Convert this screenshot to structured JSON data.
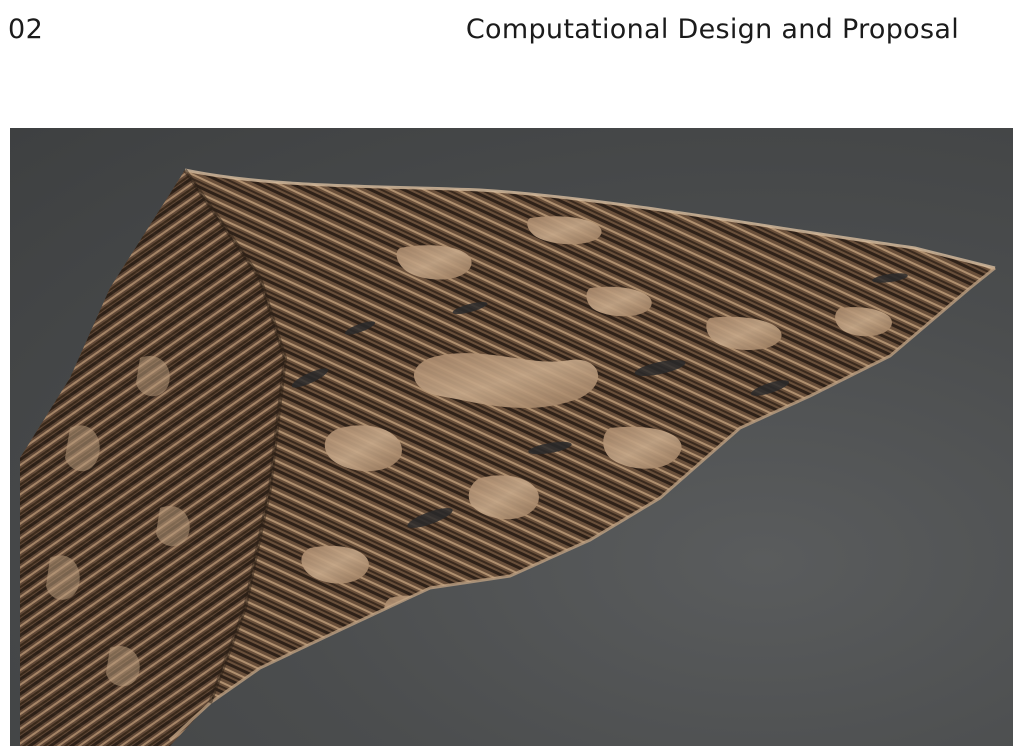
{
  "header": {
    "chapter_number": "02",
    "chapter_title": "Computational Design and Proposal"
  },
  "figure": {
    "subject_icon": "wood-lattice-render",
    "colors": {
      "background": "#4b4d4e",
      "wood_light": "#c7a98a",
      "wood_dark": "#3a2a1e",
      "groove": "#5b4433"
    }
  }
}
